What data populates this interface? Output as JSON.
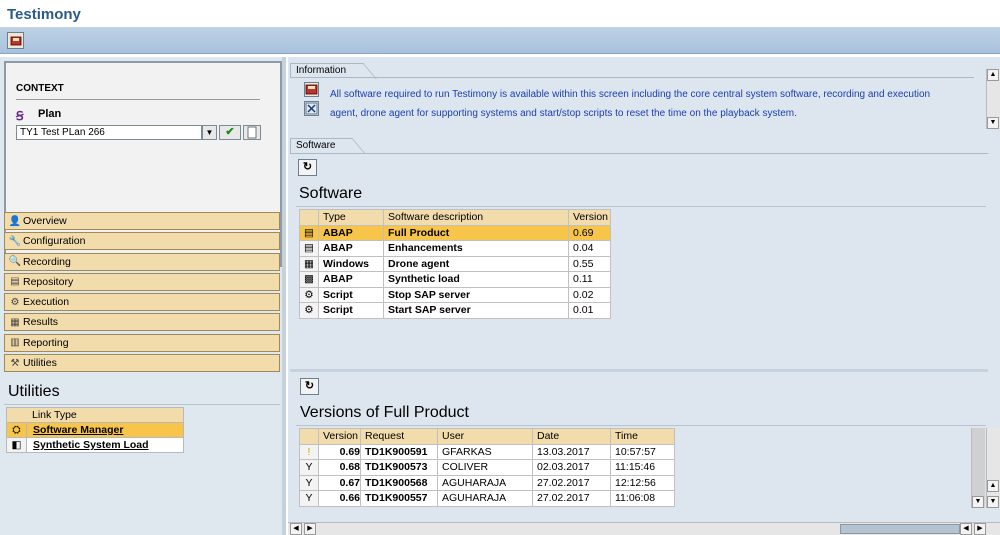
{
  "app": {
    "title": "Testimony"
  },
  "context": {
    "heading": "CONTEXT",
    "plan_label": "Plan",
    "plan_value": "TY1 Test PLan 266"
  },
  "nav": [
    {
      "label": "Overview",
      "icon": "overview-icon",
      "glyph": "👤"
    },
    {
      "label": "Configuration",
      "icon": "configuration-icon",
      "glyph": "🔧"
    },
    {
      "label": "Recording",
      "icon": "recording-icon",
      "glyph": "🔍"
    },
    {
      "label": "Repository",
      "icon": "repository-icon",
      "glyph": "▤"
    },
    {
      "label": "Execution",
      "icon": "execution-icon",
      "glyph": "⚙"
    },
    {
      "label": "Results",
      "icon": "results-icon",
      "glyph": "▦"
    },
    {
      "label": "Reporting",
      "icon": "reporting-icon",
      "glyph": "▥"
    },
    {
      "label": "Utilities",
      "icon": "utilities-icon",
      "glyph": "⚒"
    }
  ],
  "utilities": {
    "heading": "Utilities",
    "column": "Link Type",
    "links": [
      {
        "label": "Software Manager",
        "icon": "software-manager-icon",
        "selected": true
      },
      {
        "label": "Synthetic System Load",
        "icon": "synthetic-load-icon",
        "selected": false
      }
    ]
  },
  "information": {
    "tab": "Information",
    "text": "All software required to run Testimony is available within this screen including the core central system software, recording and execution agent, drone agent for supporting systems and start/stop scripts to reset the time on the playback system."
  },
  "software": {
    "tab": "Software",
    "heading": "Software",
    "columns": [
      "Type",
      "Software description",
      "Version"
    ],
    "rows": [
      {
        "icon": "document-icon",
        "type": "ABAP",
        "desc": "Full Product",
        "version": "0.69",
        "selected": true
      },
      {
        "icon": "document-icon",
        "type": "ABAP",
        "desc": "Enhancements",
        "version": "0.04",
        "selected": false
      },
      {
        "icon": "windows-icon",
        "type": "Windows",
        "desc": "Drone agent",
        "version": "0.55",
        "selected": false
      },
      {
        "icon": "grid-icon",
        "type": "ABAP",
        "desc": "Synthetic load",
        "version": "0.11",
        "selected": false
      },
      {
        "icon": "gear-icon",
        "type": "Script",
        "desc": "Stop SAP server",
        "version": "0.02",
        "selected": false
      },
      {
        "icon": "gear-icon",
        "type": "Script",
        "desc": "Start SAP server",
        "version": "0.01",
        "selected": false
      }
    ]
  },
  "versions": {
    "heading": "Versions of Full Product",
    "columns": [
      "Version",
      "Request",
      "User",
      "Date",
      "Time"
    ],
    "rows": [
      {
        "icon": "pin-yellow-icon",
        "version": "0.69",
        "request": "TD1K900591",
        "user": "GFARKAS",
        "date": "13.03.2017",
        "time": "10:57:57"
      },
      {
        "icon": "pin-icon",
        "version": "0.68",
        "request": "TD1K900573",
        "user": "COLIVER",
        "date": "02.03.2017",
        "time": "11:15:46"
      },
      {
        "icon": "pin-icon",
        "version": "0.67",
        "request": "TD1K900568",
        "user": "AGUHARAJA",
        "date": "27.02.2017",
        "time": "12:12:56"
      },
      {
        "icon": "pin-icon",
        "version": "0.66",
        "request": "TD1K900557",
        "user": "AGUHARAJA",
        "date": "27.02.2017",
        "time": "11:06:08"
      }
    ]
  }
}
